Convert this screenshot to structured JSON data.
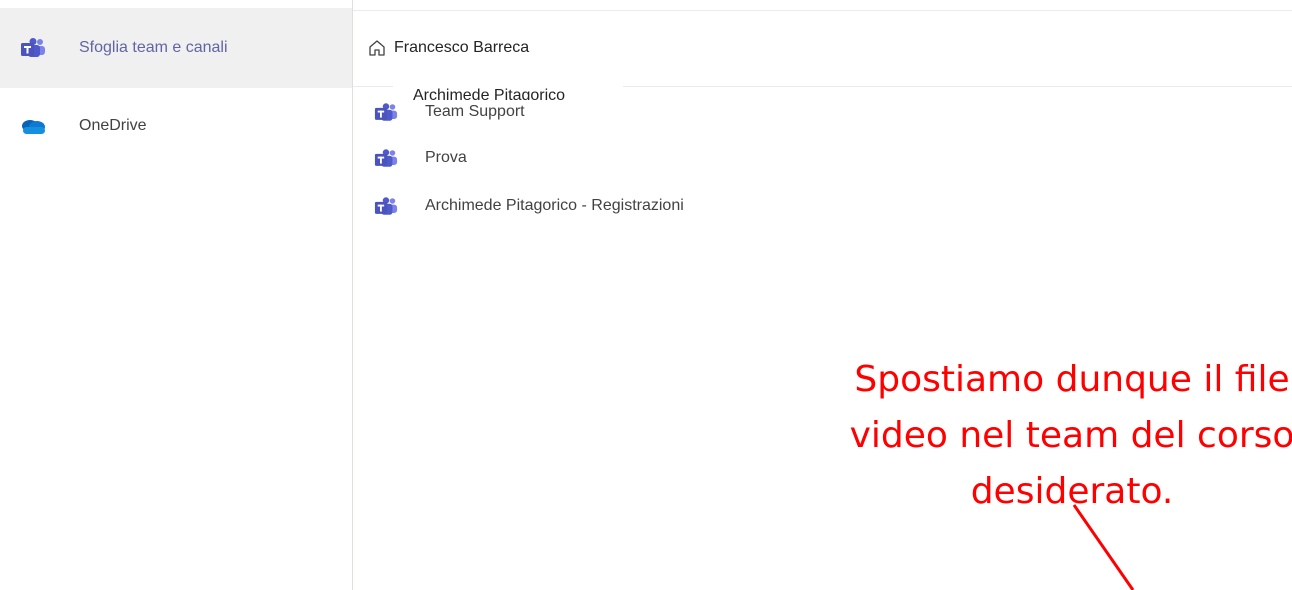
{
  "sidebar": {
    "items": [
      {
        "label": "Sfoglia team e canali",
        "icon": "teams-icon",
        "active": true
      },
      {
        "label": "OneDrive",
        "icon": "onedrive-icon",
        "active": false
      }
    ]
  },
  "breadcrumb": {
    "home_icon": "home-icon",
    "label": "Francesco Barreca"
  },
  "tooltip": {
    "label": "Archimede Pitagorico"
  },
  "teams": [
    {
      "label": "Team Support",
      "icon": "teams-icon"
    },
    {
      "label": "Prova",
      "icon": "teams-icon"
    },
    {
      "label": "Archimede Pitagorico - Registrazioni",
      "icon": "teams-icon"
    }
  ],
  "annotation": {
    "line1": "Spostiamo dunque il file",
    "line2": "video nel team del corso",
    "line3": "desiderato.",
    "color": "#ff0000"
  },
  "colors": {
    "teams_purple": "#5b5fc7",
    "onedrive_blue": "#0f78d4",
    "active_bg": "#f0f0f0"
  }
}
